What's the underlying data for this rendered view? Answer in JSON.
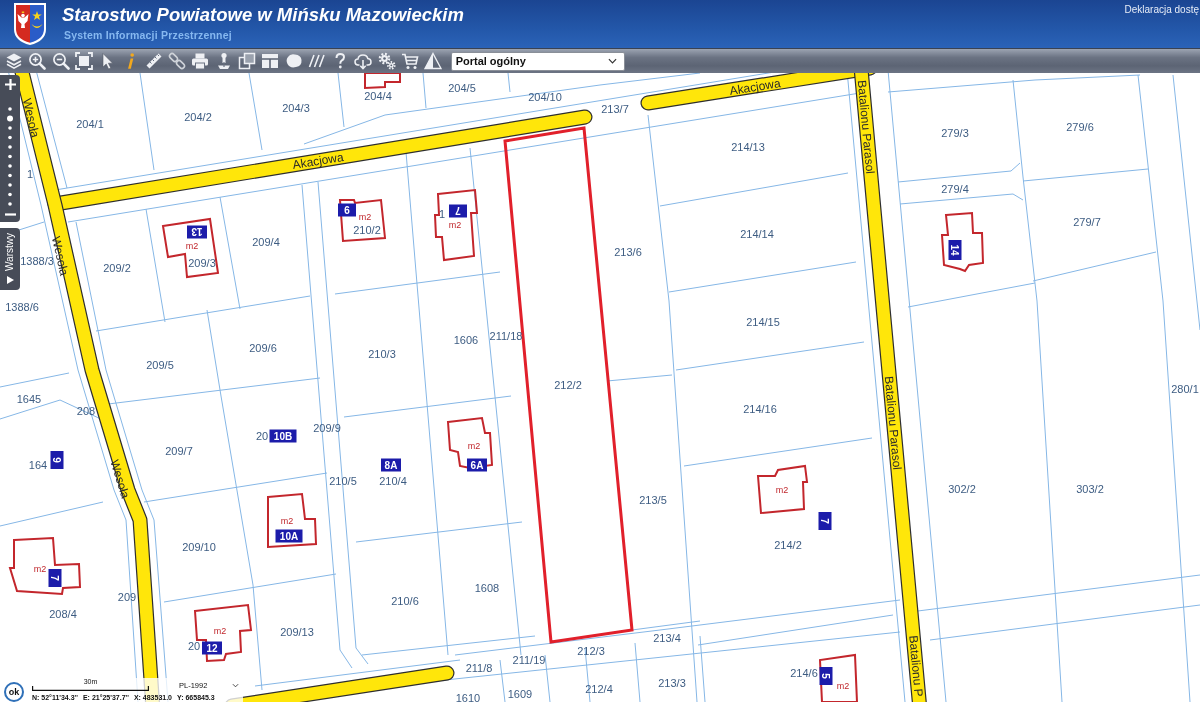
{
  "header": {
    "title": "Starostwo Powiatowe w Mińsku Mazowieckim",
    "subtitle": "System Informacji Przestrzennej",
    "link": "Deklaracja dostę"
  },
  "toolbar": {
    "portal_select": {
      "value": "Portal ogólny"
    }
  },
  "zoom_slider": {
    "level": 0.9
  },
  "layers_tab": {
    "label": "Warstwy"
  },
  "map": {
    "street_labels": [
      "Akacjowa",
      "Akacjowa",
      "Wesoła",
      "Wesoła",
      "Wesoła",
      "Batalionu Parasol",
      "Batalionu Parasol",
      "Batalionu P"
    ],
    "parcel_numbers": [
      "204/4",
      "204/5",
      "204/10",
      "213/7",
      "204/3",
      "204/2",
      "204/1",
      "279/6",
      "279/3",
      "214/13",
      "1",
      "279/4",
      "1",
      "279/7",
      "210/2",
      "214/14",
      "209/4",
      "213/6",
      "1388/3",
      "209/2",
      "209/3",
      "1388/6",
      "214/15",
      "211/18",
      "1606",
      "209/6",
      "210/3",
      "209/5",
      "212/2",
      "280/1",
      "1645",
      "214/16",
      "208",
      "209/9",
      "20",
      "209/7",
      "164",
      "210/4",
      "210/5",
      "302/2",
      "303/2",
      "213/5",
      "214/2",
      "209/10",
      "1608",
      "209",
      "210/6",
      "208/4",
      "209/13",
      "213/4",
      "20",
      "212/3",
      "211/19",
      "211/8",
      "214/6",
      "213/3",
      "212/4",
      "1609",
      "1610"
    ],
    "house_numbers": [
      "9",
      "7",
      "13",
      "14",
      "10B",
      "9",
      "6A",
      "8A",
      "7",
      "10A",
      "7",
      "12",
      "5"
    ],
    "building_labels": [
      "m2",
      "m2",
      "m2",
      "m2",
      "m2",
      "m2",
      "m2",
      "m2",
      "m2"
    ]
  },
  "status_bar": {
    "ok_button": "ok",
    "scale": "30m",
    "projection": "PL-1992",
    "coordinates": [
      "N: 52°11'34.3''",
      "E: 21°25'37.7''",
      "X: 483531.0",
      "Y: 665845.3"
    ]
  }
}
